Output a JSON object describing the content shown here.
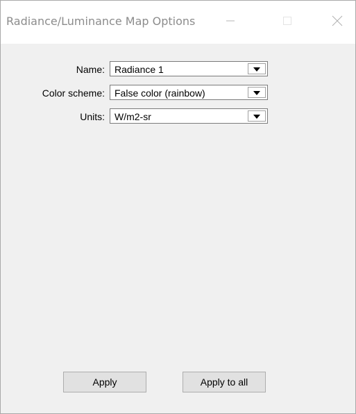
{
  "window": {
    "title": "Radiance/Luminance Map Options",
    "controls": {
      "minimize": "minimize-icon",
      "maximize": "maximize-icon",
      "close": "close-icon"
    }
  },
  "form": {
    "name": {
      "label": "Name:",
      "value": "Radiance 1"
    },
    "color_scheme": {
      "label": "Color scheme:",
      "value": "False color (rainbow)"
    },
    "units": {
      "label": "Units:",
      "value": "W/m2-sr"
    }
  },
  "buttons": {
    "apply": "Apply",
    "apply_to_all": "Apply to all"
  },
  "colors": {
    "title_text": "#8c8c8c",
    "client_bg": "#f0f0f0",
    "button_bg": "#e1e1e1"
  }
}
